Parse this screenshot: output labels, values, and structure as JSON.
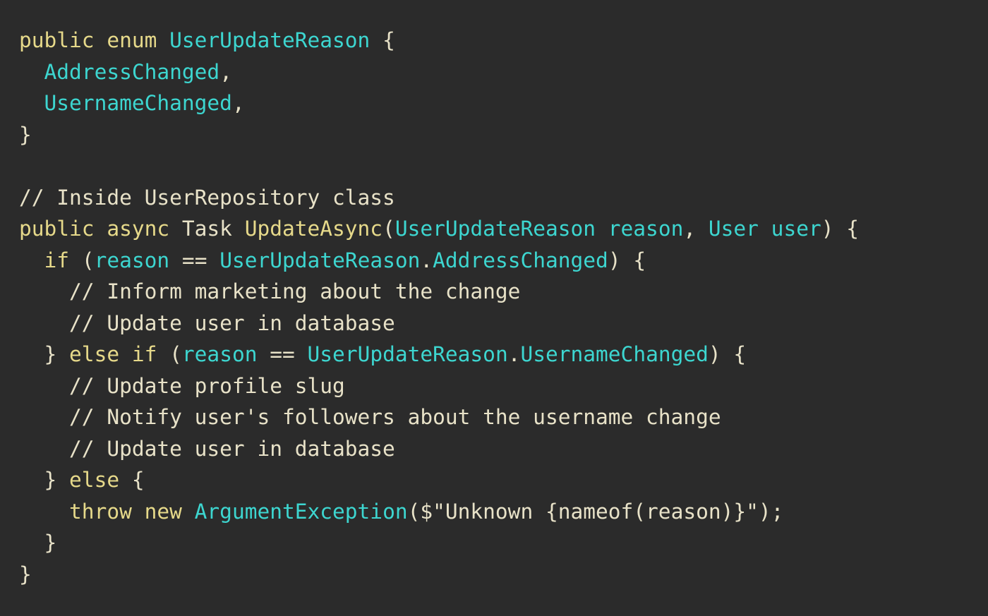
{
  "colors": {
    "background": "#2b2b2b",
    "keyword": "#e6d98a",
    "type": "#3dd6d0",
    "plain": "#e8e2c8"
  },
  "code": {
    "lines": [
      [
        {
          "t": "public enum ",
          "k": "kw"
        },
        {
          "t": "UserUpdateReason",
          "k": "type"
        },
        {
          "t": " {",
          "k": "plain"
        }
      ],
      [
        {
          "t": "  ",
          "k": "plain"
        },
        {
          "t": "AddressChanged",
          "k": "type"
        },
        {
          "t": ",",
          "k": "plain"
        }
      ],
      [
        {
          "t": "  ",
          "k": "plain"
        },
        {
          "t": "UsernameChanged",
          "k": "type"
        },
        {
          "t": ",",
          "k": "plain"
        }
      ],
      [
        {
          "t": "}",
          "k": "plain"
        }
      ],
      [],
      [
        {
          "t": "// Inside UserRepository class",
          "k": "comment"
        }
      ],
      [
        {
          "t": "public async ",
          "k": "kw"
        },
        {
          "t": "Task ",
          "k": "plain"
        },
        {
          "t": "UpdateAsync",
          "k": "fn"
        },
        {
          "t": "(",
          "k": "plain"
        },
        {
          "t": "UserUpdateReason reason",
          "k": "type"
        },
        {
          "t": ", ",
          "k": "plain"
        },
        {
          "t": "User user",
          "k": "type"
        },
        {
          "t": ") {",
          "k": "plain"
        }
      ],
      [
        {
          "t": "  ",
          "k": "plain"
        },
        {
          "t": "if ",
          "k": "kw"
        },
        {
          "t": "(",
          "k": "plain"
        },
        {
          "t": "reason",
          "k": "type"
        },
        {
          "t": " == ",
          "k": "plain"
        },
        {
          "t": "UserUpdateReason",
          "k": "type"
        },
        {
          "t": ".",
          "k": "plain"
        },
        {
          "t": "AddressChanged",
          "k": "type"
        },
        {
          "t": ") {",
          "k": "plain"
        }
      ],
      [
        {
          "t": "    // Inform marketing about the change",
          "k": "comment"
        }
      ],
      [
        {
          "t": "    // Update user in database",
          "k": "comment"
        }
      ],
      [
        {
          "t": "  } ",
          "k": "plain"
        },
        {
          "t": "else if ",
          "k": "kw"
        },
        {
          "t": "(",
          "k": "plain"
        },
        {
          "t": "reason",
          "k": "type"
        },
        {
          "t": " == ",
          "k": "plain"
        },
        {
          "t": "UserUpdateReason",
          "k": "type"
        },
        {
          "t": ".",
          "k": "plain"
        },
        {
          "t": "UsernameChanged",
          "k": "type"
        },
        {
          "t": ") {",
          "k": "plain"
        }
      ],
      [
        {
          "t": "    // Update profile slug",
          "k": "comment"
        }
      ],
      [
        {
          "t": "    // Notify user's followers about the username change",
          "k": "comment"
        }
      ],
      [
        {
          "t": "    // Update user in database",
          "k": "comment"
        }
      ],
      [
        {
          "t": "  } ",
          "k": "plain"
        },
        {
          "t": "else",
          "k": "kw"
        },
        {
          "t": " {",
          "k": "plain"
        }
      ],
      [
        {
          "t": "    ",
          "k": "plain"
        },
        {
          "t": "throw new ",
          "k": "kw"
        },
        {
          "t": "ArgumentException",
          "k": "type"
        },
        {
          "t": "($\"Unknown {nameof(reason)}\");",
          "k": "str"
        }
      ],
      [
        {
          "t": "  }",
          "k": "plain"
        }
      ],
      [
        {
          "t": "}",
          "k": "plain"
        }
      ]
    ]
  }
}
